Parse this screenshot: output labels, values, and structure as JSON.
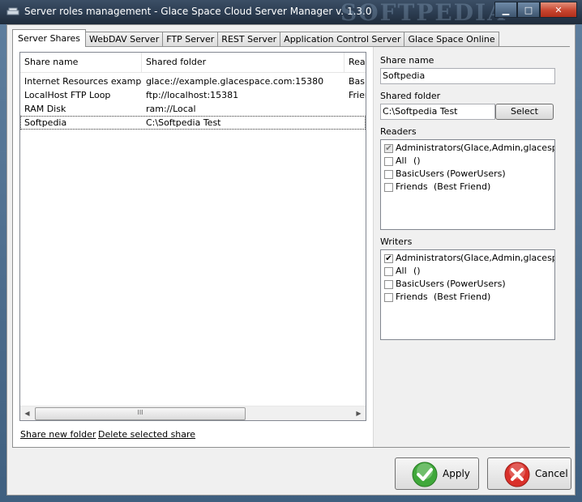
{
  "window": {
    "title": "Server roles management - Glace Space Cloud Server Manager v. 1.3.0",
    "watermark": "SOFTPEDIA"
  },
  "tabs": [
    {
      "label": "Server Shares",
      "active": true
    },
    {
      "label": "WebDAV Server"
    },
    {
      "label": "FTP Server"
    },
    {
      "label": "REST Server"
    },
    {
      "label": "Application Control Server"
    },
    {
      "label": "Glace Space Online"
    }
  ],
  "shares": {
    "columns": [
      "Share name",
      "Shared folder",
      "Rea"
    ],
    "rows": [
      {
        "name": "Internet Resources example",
        "folder": "glace://example.glacespace.com:15380",
        "readers": "Basic"
      },
      {
        "name": "LocalHost FTP Loop",
        "folder": "ftp://localhost:15381",
        "readers": "Frien"
      },
      {
        "name": "RAM Disk",
        "folder": "ram://Local",
        "readers": ""
      },
      {
        "name": "Softpedia",
        "folder": "C:\\Softpedia Test",
        "readers": "",
        "selected": true
      }
    ],
    "scroll_grip": "III"
  },
  "links": {
    "share_new": "Share new folder",
    "delete_selected": "Delete selected share"
  },
  "details": {
    "share_name_label": "Share name",
    "share_name_value": "Softpedia",
    "shared_folder_label": "Shared folder",
    "shared_folder_value": "C:\\Softpedia Test",
    "select_label": "Select",
    "readers_label": "Readers",
    "readers": [
      {
        "name": "Administrators",
        "members": "(Glace,Admin,glacespace",
        "checked": true,
        "dim": true
      },
      {
        "name": "All",
        "members": "()",
        "checked": false
      },
      {
        "name": "BasicUsers",
        "members": "(PowerUsers)",
        "checked": false
      },
      {
        "name": "Friends",
        "members": "(Best Friend)",
        "checked": false
      }
    ],
    "writers_label": "Writers",
    "writers": [
      {
        "name": "Administrators",
        "members": "(Glace,Admin,glacespace",
        "checked": true
      },
      {
        "name": "All",
        "members": "()",
        "checked": false
      },
      {
        "name": "BasicUsers",
        "members": "(PowerUsers)",
        "checked": false
      },
      {
        "name": "Friends",
        "members": "(Best Friend)",
        "checked": false
      }
    ]
  },
  "buttons": {
    "apply": "Apply",
    "cancel": "Cancel"
  },
  "colors": {
    "apply_green": "#3fa83a",
    "cancel_red": "#d9302a"
  }
}
